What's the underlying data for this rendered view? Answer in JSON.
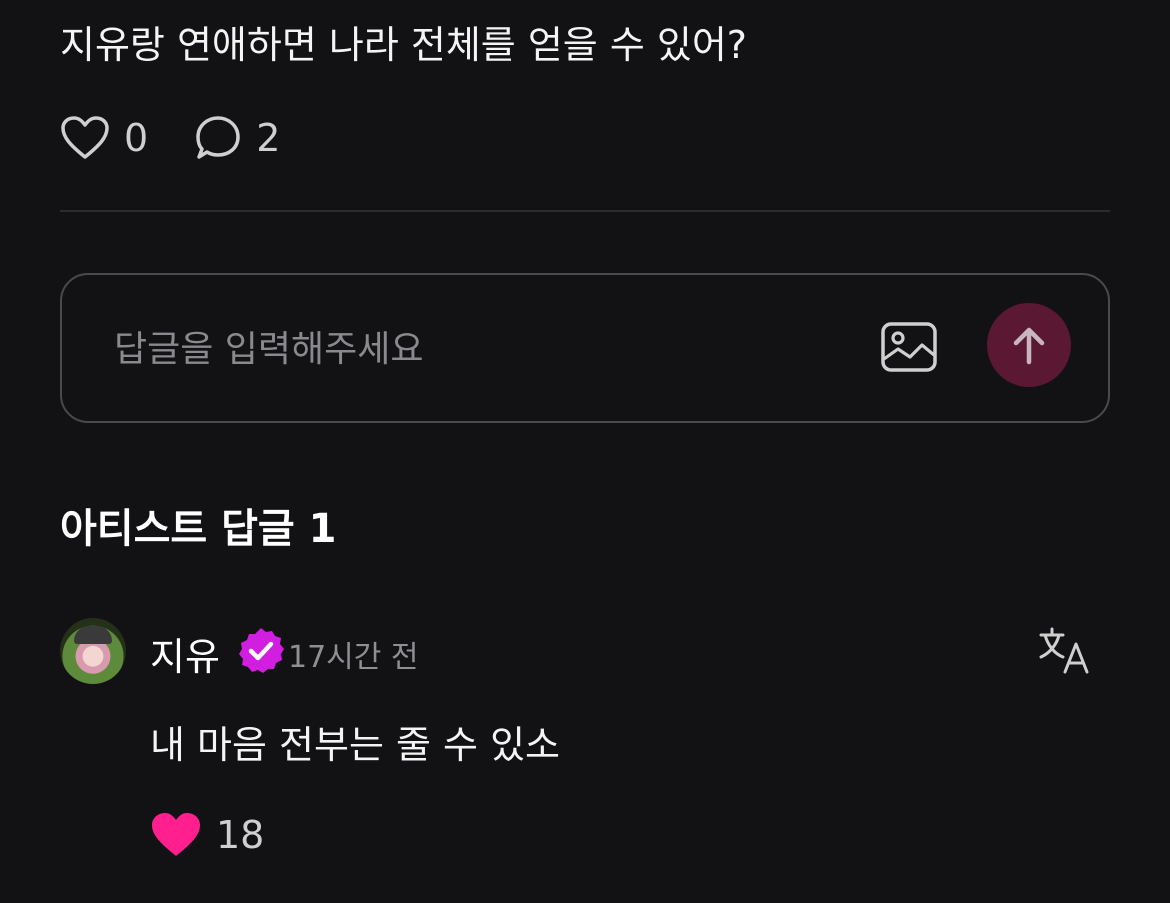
{
  "post": {
    "text": "지유랑 연애하면 나라 전체를 얻을 수 있어?",
    "like_count": "0",
    "comment_count": "2"
  },
  "reply_input": {
    "placeholder": "답글을 입력해주세요"
  },
  "artist_replies": {
    "title": "아티스트 답글 1",
    "comments": [
      {
        "author": "지유",
        "time": "17시간 전",
        "text": "내 마음 전부는 줄 수 있소",
        "like_count": "18"
      }
    ]
  },
  "colors": {
    "background": "#121113",
    "accent_pink": "#ff1f8e",
    "verified_magenta": "#d21ee0",
    "send_button": "#5a1833"
  },
  "icons": {
    "like": "heart-outline-icon",
    "comment": "comment-bubble-icon",
    "image": "image-icon",
    "send": "arrow-up-icon",
    "verified": "verified-badge-icon",
    "translate": "translate-icon",
    "liked": "heart-filled-icon"
  }
}
